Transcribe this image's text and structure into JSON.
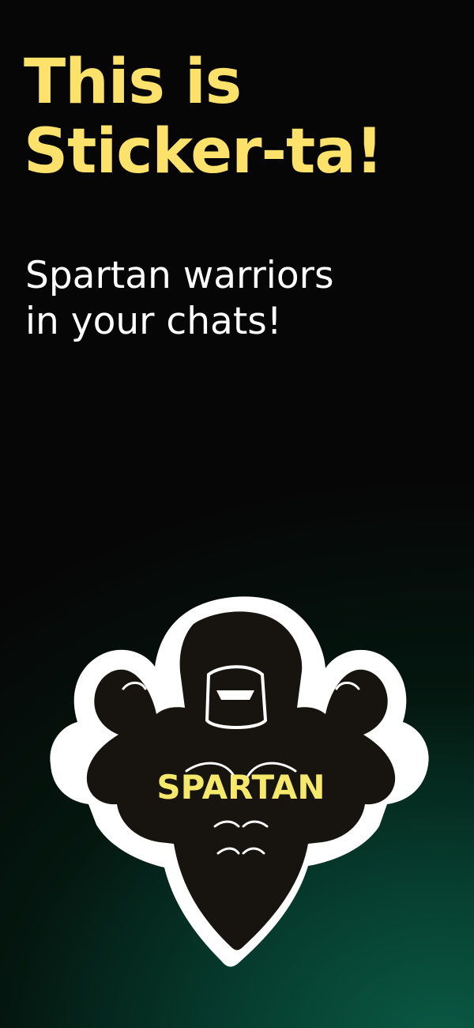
{
  "colors": {
    "headline": "#FCE26B",
    "subhead": "#FFFFFF",
    "background_top": "#060606",
    "background_glow": "#0A5A44",
    "sticker_outline": "#FFFFFF",
    "sticker_ink": "#17130F",
    "badge_text": "#F5E86A"
  },
  "hero": {
    "title_line1": "This is",
    "title_line2": "Sticker-ta!",
    "subtitle_line1": "Spartan warriors",
    "subtitle_line2": "in your chats!"
  },
  "sticker": {
    "icon": "spartan-warrior-sticker",
    "badge_text": "SPARTAN"
  }
}
